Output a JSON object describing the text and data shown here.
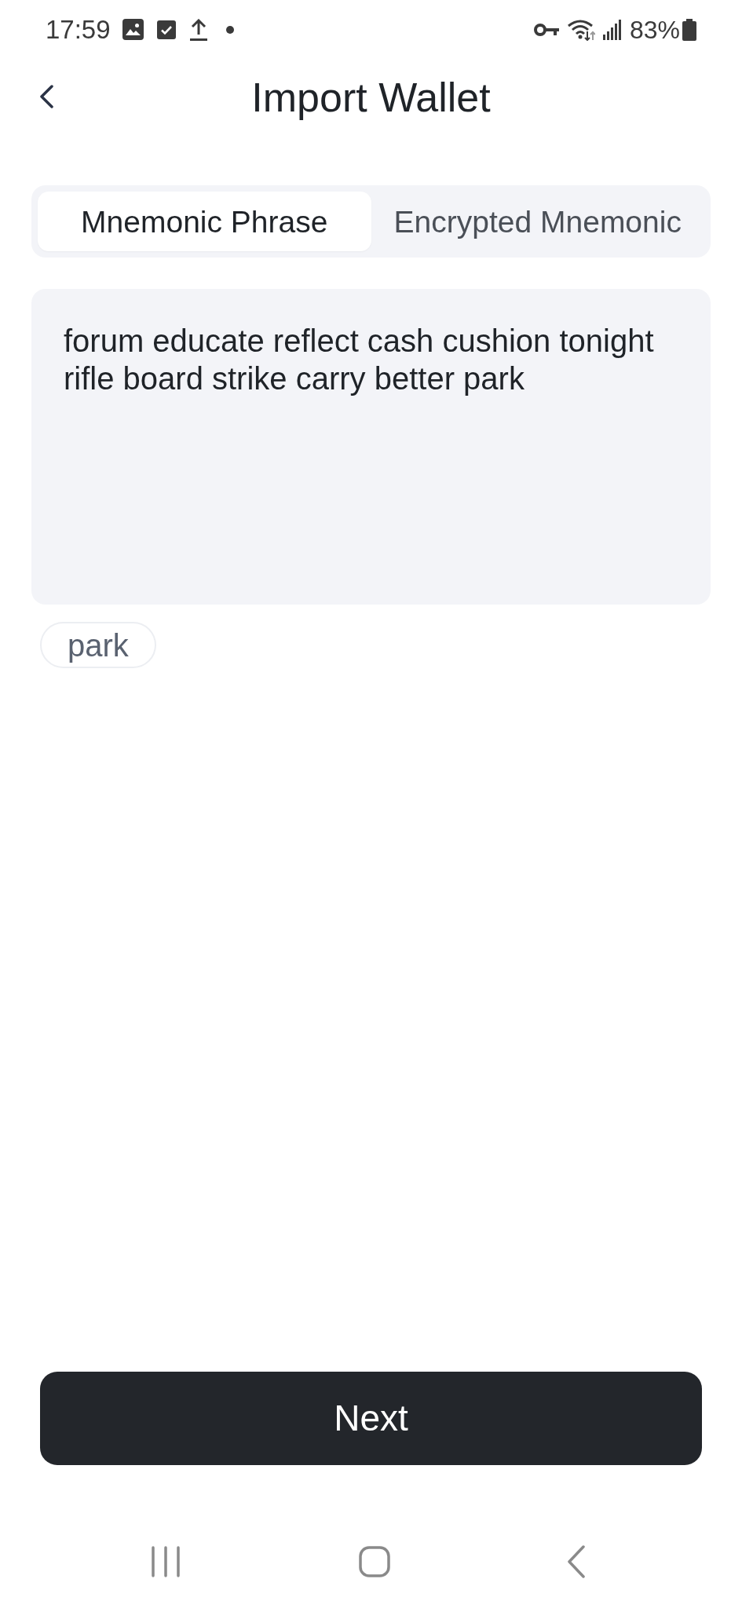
{
  "status_bar": {
    "time": "17:59",
    "battery": "83%"
  },
  "header": {
    "title": "Import Wallet"
  },
  "tabs": [
    {
      "label": "Mnemonic Phrase",
      "selected": true
    },
    {
      "label": "Encrypted Mnemonic",
      "selected": false
    }
  ],
  "phrase_input": {
    "value": "forum educate reflect cash cushion tonight rifle board strike carry better park"
  },
  "suggestions": [
    {
      "label": "park"
    }
  ],
  "primary_button": {
    "label": "Next"
  }
}
